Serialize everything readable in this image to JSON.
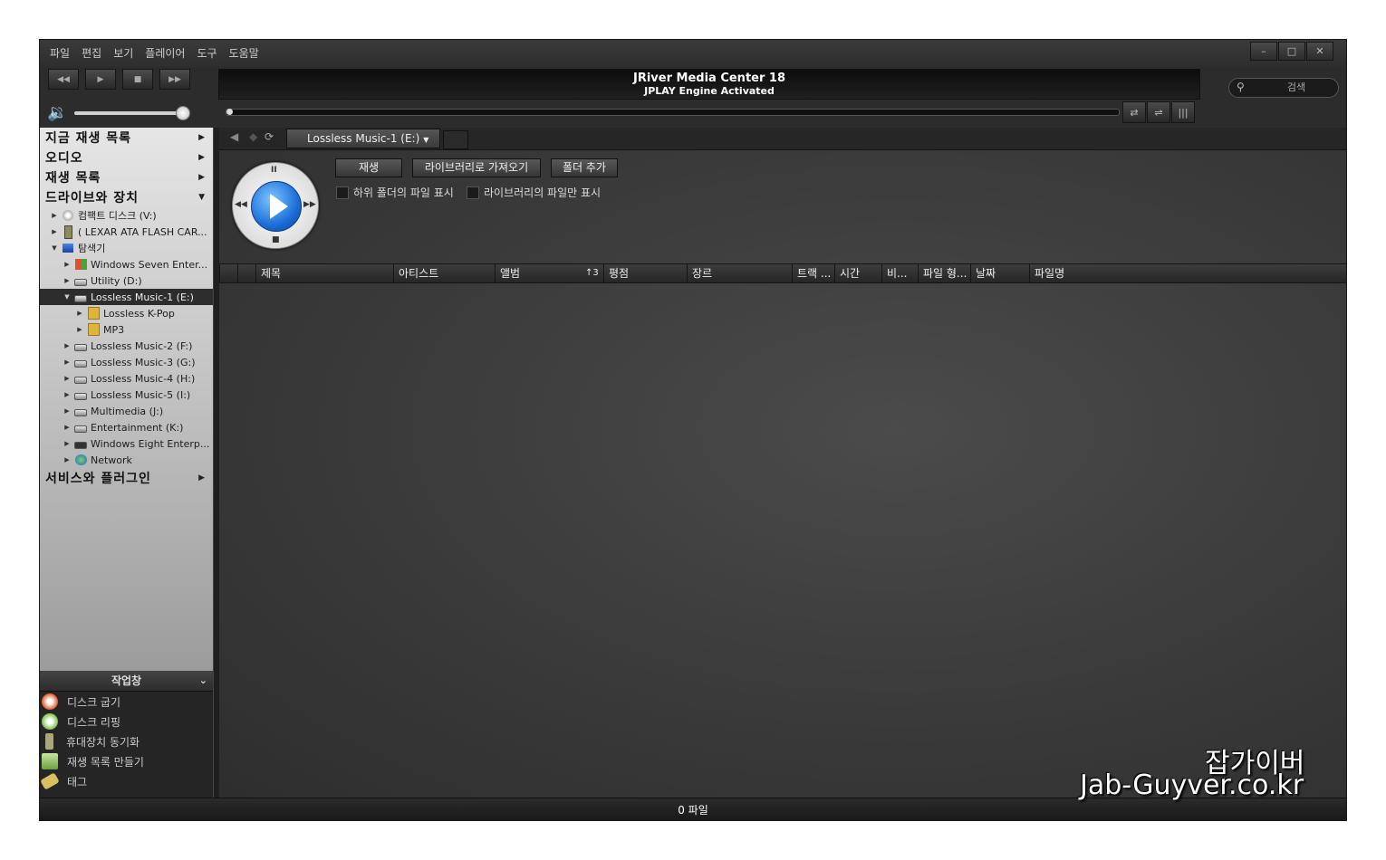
{
  "menu": [
    "파일",
    "편집",
    "보기",
    "플레이어",
    "도구",
    "도움말"
  ],
  "window_controls": {
    "minimize": "–",
    "maximize": "□",
    "close": "✕"
  },
  "transport": {
    "prev": "◀◀",
    "play": "▶",
    "stop": "■",
    "next": "▶▶"
  },
  "display": {
    "title": "JRiver Media Center 18",
    "subtitle": "JPLAY Engine Activated"
  },
  "search": {
    "placeholder": "검색"
  },
  "sidebar": {
    "sections": {
      "now_playing": "지금 재생 목록",
      "audio": "오디오",
      "playlists": "재생 목록",
      "drives": "드라이브와 장치",
      "services": "서비스와 플러그인"
    },
    "tree": [
      {
        "label": "컴팩트 디스크 (V:)",
        "icon": "disc-icon"
      },
      {
        "label": "( LEXAR ATA FLASH CAR...",
        "icon": "usb-drive-icon"
      },
      {
        "label": "탐색기",
        "icon": "explorer-icon"
      },
      {
        "label": "Windows Seven Enter...",
        "icon": "windows-drive-icon"
      },
      {
        "label": "Utility (D:)",
        "icon": "hard-drive-icon"
      },
      {
        "label": "Lossless Music-1 (E:)",
        "icon": "hard-drive-icon",
        "selected": true
      },
      {
        "label": "Lossless K-Pop",
        "icon": "folder-icon"
      },
      {
        "label": "MP3",
        "icon": "folder-icon"
      },
      {
        "label": "Lossless Music-2 (F:)",
        "icon": "hard-drive-icon"
      },
      {
        "label": "Lossless Music-3 (G:)",
        "icon": "hard-drive-icon"
      },
      {
        "label": "Lossless Music-4 (H:)",
        "icon": "hard-drive-icon"
      },
      {
        "label": "Lossless Music-5 (I:)",
        "icon": "hard-drive-icon"
      },
      {
        "label": "Multimedia (J:)",
        "icon": "hard-drive-icon"
      },
      {
        "label": "Entertainment (K:)",
        "icon": "hard-drive-icon"
      },
      {
        "label": "Windows Eight Enterp...",
        "icon": "hard-drive-icon"
      },
      {
        "label": "Network",
        "icon": "network-icon"
      }
    ]
  },
  "actions": {
    "title": "작업창",
    "items": [
      "디스크 굽기",
      "디스크 리핑",
      "휴대장치 동기화",
      "재생 목록 만들기",
      "태그"
    ]
  },
  "main": {
    "tab_label": "Lossless Music-1 (E:)",
    "buttons": {
      "play": "재생",
      "import": "라이브러리로 가져오기",
      "add_folder": "폴더 추가"
    },
    "checkboxes": {
      "subfolders": "하위 폴더의 파일 표시",
      "library_only": "라이브러리의 파일만 표시"
    },
    "columns": [
      "제목",
      "아티스트",
      "앨범",
      "↑3",
      "평점",
      "장르",
      "트랙 ...",
      "시간",
      "비...",
      "파일 형...",
      "날짜",
      "파일명"
    ]
  },
  "status": "0 파일",
  "watermark": {
    "line1": "잡가이버",
    "line2": "Jab-Guyver.co.kr"
  },
  "colors": {
    "accent_blue": "#1c6fd8",
    "window_bg": "#2c2c2c",
    "sidebar_top": "#e6e6e6"
  }
}
